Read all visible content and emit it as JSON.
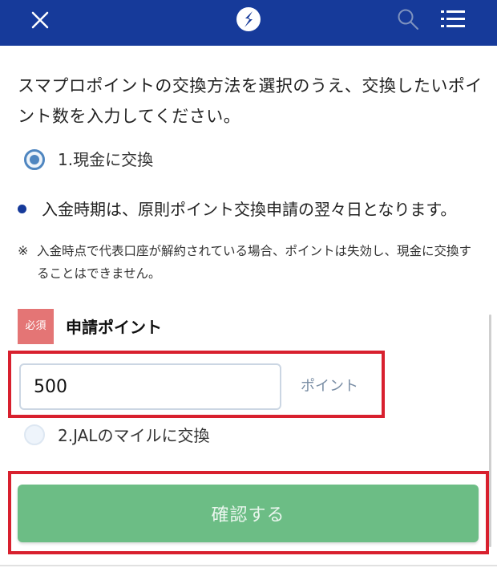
{
  "header": {
    "background_color": "#163a9a",
    "close_icon": "close-icon",
    "logo_icon": "logo-icon",
    "search_icon": "search-icon",
    "menu_icon": "menu-icon"
  },
  "intro_text": "スマプロポイントの交換方法を選択のうえ、交換したいポイント数を入力してください。",
  "options": [
    {
      "label": "1.現金に交換",
      "selected": true
    },
    {
      "label": "2.JALのマイルに交換",
      "selected": false
    }
  ],
  "bullet_text": "入金時期は、原則ポイント交換申請の翌々日となります。",
  "note": {
    "mark": "※",
    "text": "入金時点で代表口座が解約されている場合、ポイントは失効し、現金に交換することはできません。"
  },
  "form": {
    "required_badge": "必須",
    "field_label": "申請ポイント",
    "value": "500",
    "unit": "ポイント"
  },
  "confirm_button": "確認する",
  "colors": {
    "header": "#163a9a",
    "radio_accent": "#4f86c0",
    "required_badge": "#e47575",
    "confirm_button": "#6cbd85",
    "highlight_border": "#d8202e"
  }
}
